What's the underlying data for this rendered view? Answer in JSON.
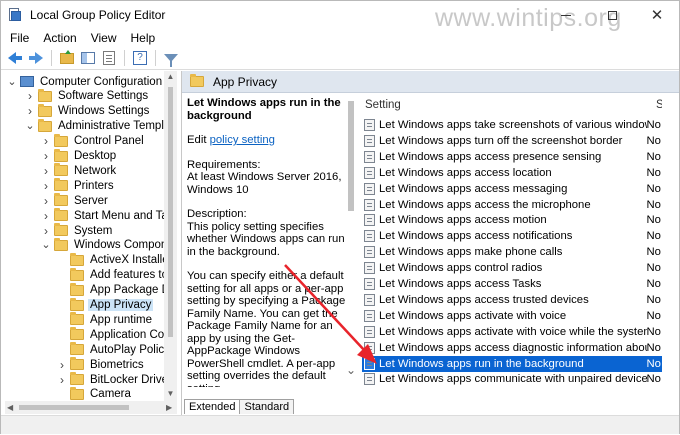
{
  "window": {
    "title": "Local Group Policy Editor",
    "watermark": "www.wintips.org",
    "minimize_glyph": "—",
    "close_glyph": "✕"
  },
  "menu": [
    "File",
    "Action",
    "View",
    "Help"
  ],
  "toolbar": {
    "icons": [
      "back-icon",
      "forward-icon",
      "up-folder-icon",
      "show-hide-pane-icon",
      "properties-icon",
      "help-icon",
      "filter-icon"
    ]
  },
  "tree": {
    "items": [
      {
        "label": "Computer Configuration",
        "twisty": "v",
        "kind": "computer"
      },
      {
        "label": "Software Settings",
        "twisty": ">",
        "kind": "folder"
      },
      {
        "label": "Windows Settings",
        "twisty": ">",
        "kind": "folder"
      },
      {
        "label": "Administrative Templates",
        "twisty": "v",
        "kind": "folder"
      },
      {
        "label": "Control Panel",
        "twisty": ">",
        "kind": "folder"
      },
      {
        "label": "Desktop",
        "twisty": ">",
        "kind": "folder"
      },
      {
        "label": "Network",
        "twisty": ">",
        "kind": "folder"
      },
      {
        "label": "Printers",
        "twisty": ">",
        "kind": "folder"
      },
      {
        "label": "Server",
        "twisty": ">",
        "kind": "folder"
      },
      {
        "label": "Start Menu and Taskb",
        "twisty": ">",
        "kind": "folder"
      },
      {
        "label": "System",
        "twisty": ">",
        "kind": "folder"
      },
      {
        "label": "Windows Componen",
        "twisty": "v",
        "kind": "folder"
      },
      {
        "label": "ActiveX Installer S",
        "twisty": "",
        "kind": "folder"
      },
      {
        "label": "Add features to W",
        "twisty": "",
        "kind": "folder"
      },
      {
        "label": "App Package Dep",
        "twisty": "",
        "kind": "folder"
      },
      {
        "label": "App Privacy",
        "twisty": "",
        "kind": "folder",
        "selected": true
      },
      {
        "label": "App runtime",
        "twisty": "",
        "kind": "folder"
      },
      {
        "label": "Application Comp",
        "twisty": "",
        "kind": "folder"
      },
      {
        "label": "AutoPlay Policies",
        "twisty": "",
        "kind": "folder"
      },
      {
        "label": "Biometrics",
        "twisty": ">",
        "kind": "folder"
      },
      {
        "label": "BitLocker Drive Er",
        "twisty": ">",
        "kind": "folder"
      },
      {
        "label": "Camera",
        "twisty": "",
        "kind": "folder"
      }
    ]
  },
  "right": {
    "header": "App Privacy",
    "description": {
      "title": "Let Windows apps run in the background",
      "edit_prefix": "Edit",
      "edit_link": "policy setting",
      "requirements_label": "Requirements:",
      "requirements": "At least Windows Server 2016, Windows 10",
      "description_label": "Description:",
      "description": "This policy setting specifies whether Windows apps can run in the background.",
      "detail": "You can specify either a default setting for all apps or a per-app setting by specifying a Package Family Name. You can get the Package Family Name for an app by using the Get-AppPackage Windows PowerShell cmdlet. A per-app setting overrides the default setting."
    },
    "column_setting": "Setting",
    "column_state": "S",
    "settings": [
      {
        "name": "Let Windows apps take screenshots of various windows or dis...",
        "state": "No"
      },
      {
        "name": "Let Windows apps turn off the screenshot border",
        "state": "No"
      },
      {
        "name": "Let Windows apps access presence sensing",
        "state": "No"
      },
      {
        "name": "Let Windows apps access location",
        "state": "No"
      },
      {
        "name": "Let Windows apps access messaging",
        "state": "No"
      },
      {
        "name": "Let Windows apps access the microphone",
        "state": "No"
      },
      {
        "name": "Let Windows apps access motion",
        "state": "No"
      },
      {
        "name": "Let Windows apps access notifications",
        "state": "No"
      },
      {
        "name": "Let Windows apps make phone calls",
        "state": "No"
      },
      {
        "name": "Let Windows apps control radios",
        "state": "No"
      },
      {
        "name": "Let Windows apps access Tasks",
        "state": "No"
      },
      {
        "name": "Let Windows apps access trusted devices",
        "state": "No"
      },
      {
        "name": "Let Windows apps activate with voice",
        "state": "No"
      },
      {
        "name": "Let Windows apps activate with voice while the system is lock...",
        "state": "No"
      },
      {
        "name": "Let Windows apps access diagnostic information about other...",
        "state": "No"
      },
      {
        "name": "Let Windows apps run in the background",
        "state": "No",
        "selected": true
      },
      {
        "name": "Let Windows apps communicate with unpaired devices",
        "state": "No"
      }
    ],
    "tabs": [
      "Extended",
      "Standard"
    ]
  },
  "colors": {
    "selection": "#0a64d2",
    "tree_selection": "#cce4f7",
    "pane_header": "#dfe6ef",
    "annotation_arrow": "#e8242b"
  }
}
